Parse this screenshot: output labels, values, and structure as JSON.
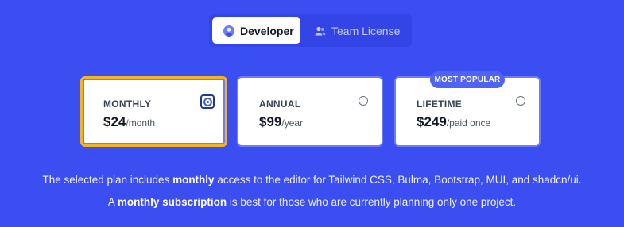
{
  "toggle": {
    "developer": "Developer",
    "team_license": "Team License"
  },
  "plans": [
    {
      "name": "MONTHLY",
      "price": "$24",
      "unit": "/month",
      "selected": true
    },
    {
      "name": "ANNUAL",
      "price": "$99",
      "unit": "/year",
      "selected": false
    },
    {
      "name": "LIFETIME",
      "price": "$249",
      "unit": "/paid once",
      "selected": false
    }
  ],
  "badge": "MOST POPULAR",
  "description": {
    "line1_pre": "The selected plan includes ",
    "line1_bold": "monthly",
    "line1_post": " access to the editor for Tailwind CSS, Bulma, Bootstrap, MUI, and shadcn/ui.",
    "line2_pre": "A ",
    "line2_bold": "monthly subscription",
    "line2_post": " is best for those who are currently planning only one project."
  },
  "colors": {
    "background": "#3b4ef2",
    "selected_border": "#f0b429",
    "card_border": "#6e7cf6"
  },
  "icons": {
    "developer": "user-circle-icon",
    "team": "users-icon"
  }
}
